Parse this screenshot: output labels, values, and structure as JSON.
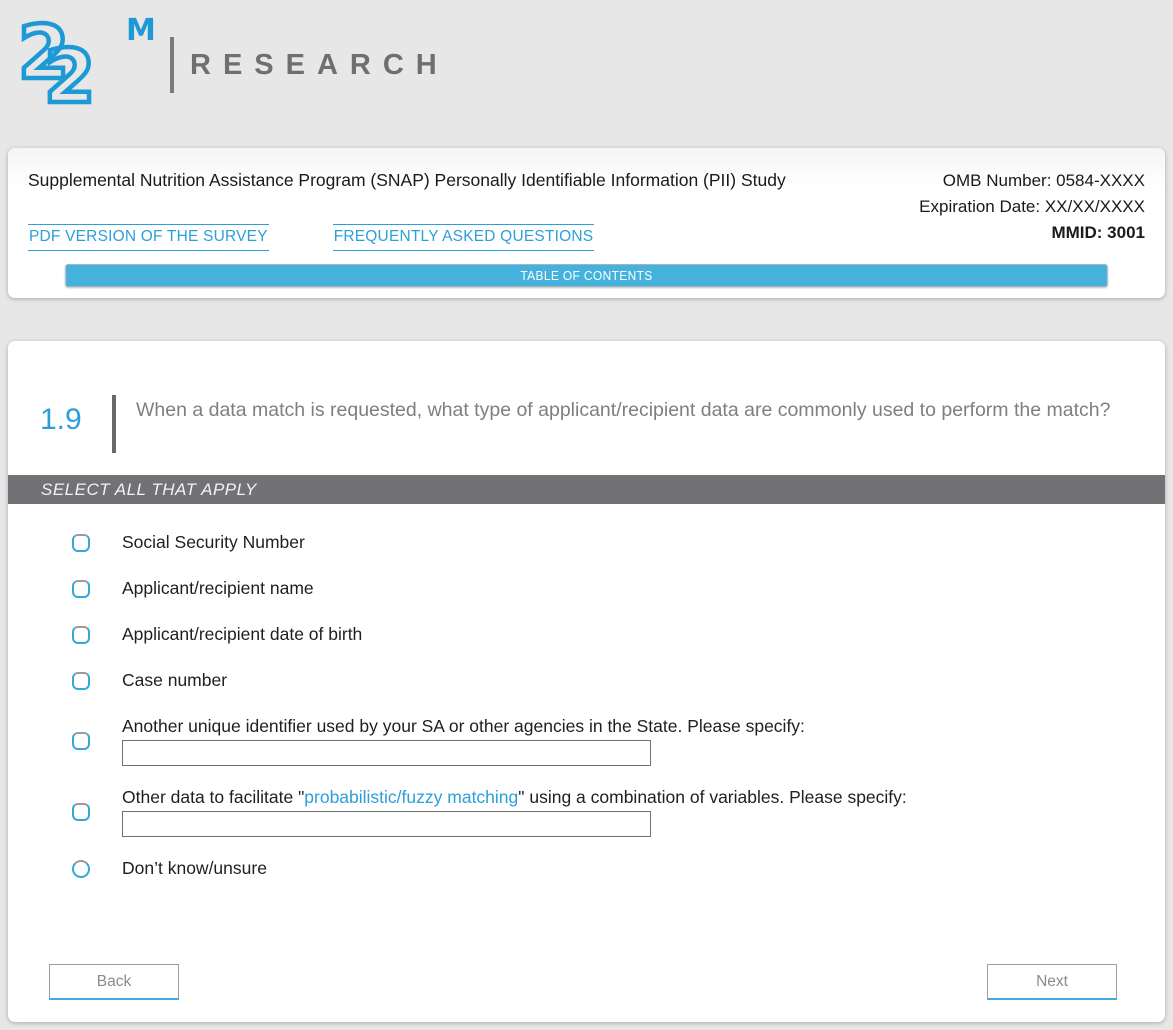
{
  "logo": {
    "mark_glyph": "2",
    "superscript": "M",
    "wordmark": "RESEARCH"
  },
  "header": {
    "title": "Supplemental Nutrition Assistance Program (SNAP) Personally Identifiable Information (PII) Study",
    "omb_number": "OMB Number: 0584-XXXX",
    "expiration_date": "Expiration Date: XX/XX/XXXX",
    "mmid": "MMID: 3001",
    "links": [
      {
        "label": "PDF VERSION OF THE SURVEY"
      },
      {
        "label": "FREQUENTLY ASKED QUESTIONS"
      }
    ],
    "toc_label": "TABLE OF CONTENTS"
  },
  "question": {
    "number": "1.9",
    "text": "When a data match is requested, what type of applicant/recipient data are commonly used to perform the match?",
    "instruction": "SELECT ALL THAT APPLY"
  },
  "options": [
    {
      "type": "checkbox",
      "label": "Social Security Number"
    },
    {
      "type": "checkbox",
      "label": "Applicant/recipient name"
    },
    {
      "type": "checkbox",
      "label": "Applicant/recipient date of birth"
    },
    {
      "type": "checkbox",
      "label": "Case number"
    },
    {
      "type": "checkbox",
      "label": "Another unique identifier used by your SA or other agencies in the State. Please specify:",
      "input_value": ""
    },
    {
      "type": "checkbox",
      "label_before": "Other data to facilitate \"",
      "link_text": "probabilistic/fuzzy matching",
      "label_after": "\" using a combination of variables. Please specify:",
      "input_value": ""
    },
    {
      "type": "radio",
      "label": "Don’t know/unsure"
    }
  ],
  "nav": {
    "back_label": "Back",
    "next_label": "Next"
  },
  "colors": {
    "accent_blue": "#45b2dd",
    "link_blue": "#2d9fd8",
    "logo_blue": "#1d9ad6",
    "bar_gray": "#717176",
    "page_background": "#e7e7e7"
  }
}
